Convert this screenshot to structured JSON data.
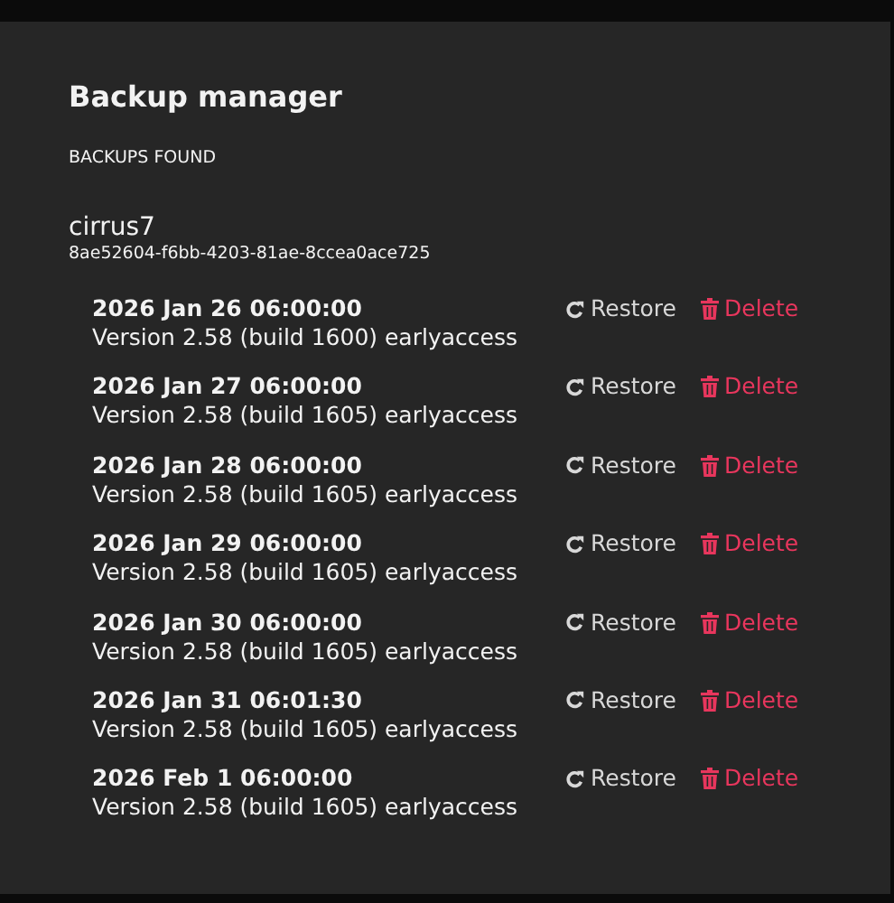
{
  "dialog": {
    "title": "Backup manager",
    "section_label": "BACKUPS FOUND"
  },
  "device": {
    "name": "cirrus7",
    "id": "8ae52604-f6bb-4203-81ae-8ccea0ace725"
  },
  "backups": [
    {
      "date": "2026 Jan 26 06:00:00",
      "version": "Version 2.58 (build 1600) earlyaccess",
      "restore": "Restore",
      "delete": "Delete"
    },
    {
      "date": "2026 Jan 27 06:00:00",
      "version": "Version 2.58 (build 1605) earlyaccess",
      "restore": "Restore",
      "delete": "Delete"
    },
    {
      "date": "2026 Jan 28 06:00:00",
      "version": "Version 2.58 (build 1605) earlyaccess",
      "restore": "Restore",
      "delete": "Delete"
    },
    {
      "date": "2026 Jan 29 06:00:00",
      "version": "Version 2.58 (build 1605) earlyaccess",
      "restore": "Restore",
      "delete": "Delete"
    },
    {
      "date": "2026 Jan 30 06:00:00",
      "version": "Version 2.58 (build 1605) earlyaccess",
      "restore": "Restore",
      "delete": "Delete"
    },
    {
      "date": "2026 Jan 31 06:01:30",
      "version": "Version 2.58 (build 1605) earlyaccess",
      "restore": "Restore",
      "delete": "Delete"
    },
    {
      "date": "2026 Feb 1 06:00:00",
      "version": "Version 2.58 (build 1605) earlyaccess",
      "restore": "Restore",
      "delete": "Delete"
    }
  ]
}
